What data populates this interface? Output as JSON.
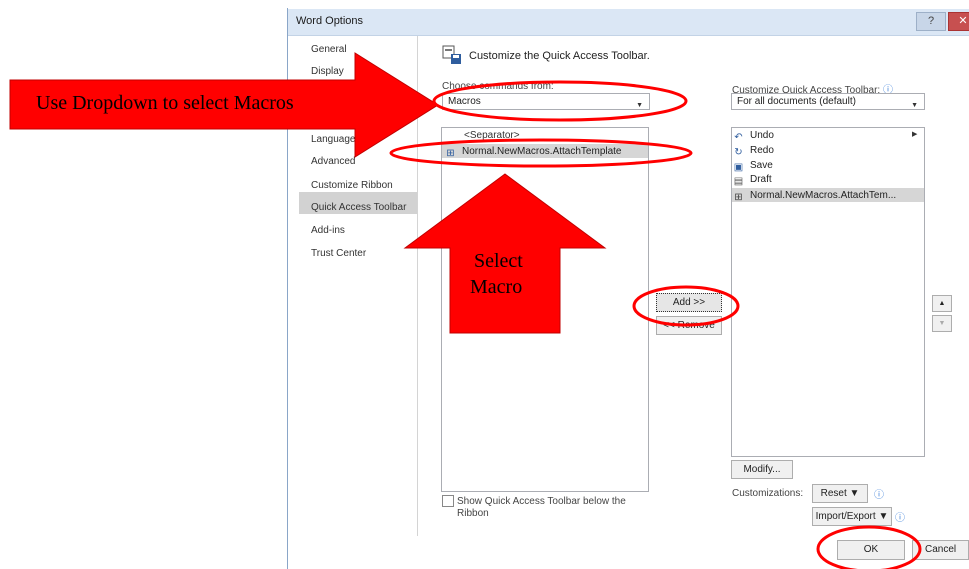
{
  "window": {
    "title": "Word Options",
    "help_glyph": "?",
    "close_glyph": "✕"
  },
  "nav": {
    "items": [
      "General",
      "Display",
      "Language",
      "Advanced",
      "Customize Ribbon",
      "Quick Access Toolbar",
      "Add-ins",
      "Trust Center"
    ],
    "selected": "Quick Access Toolbar"
  },
  "header": {
    "title": "Customize the Quick Access Toolbar."
  },
  "left": {
    "choose_label": "Choose commands from:",
    "choose_value": "Macros",
    "list_items": [
      "<Separator>",
      "Normal.NewMacros.AttachTemplate"
    ],
    "show_below_label_line1": "Show Quick Access Toolbar below the",
    "show_below_label_line2": "Ribbon"
  },
  "middle": {
    "add_label": "Add >>",
    "remove_label": "<< Remove"
  },
  "right": {
    "customize_label": "Customize Quick Access Toolbar:",
    "customize_value": "For all documents (default)",
    "list_items": [
      {
        "icon": "undo-icon",
        "glyph": "↶",
        "label": "Undo"
      },
      {
        "icon": "redo-icon",
        "glyph": "↻",
        "label": "Redo"
      },
      {
        "icon": "save-icon",
        "glyph": "▣",
        "label": "Save"
      },
      {
        "icon": "draft-icon",
        "glyph": "▤",
        "label": "Draft"
      },
      {
        "icon": "macro-icon",
        "glyph": "⊞",
        "label": "Normal.NewMacros.AttachTem..."
      }
    ],
    "modify_label": "Modify...",
    "customizations_label": "Customizations:",
    "reset_label": "Reset ▼",
    "import_export_label": "Import/Export ▼",
    "info_glyph": "ⓘ",
    "up_glyph": "▲",
    "down_glyph": "▼"
  },
  "footer": {
    "ok_label": "OK",
    "cancel_label": "Cancel"
  },
  "annotations": {
    "arrow1_text": "Use Dropdown to select Macros",
    "arrow2_line1": "Select",
    "arrow2_line2": "Macro",
    "color": "#ff0000"
  }
}
